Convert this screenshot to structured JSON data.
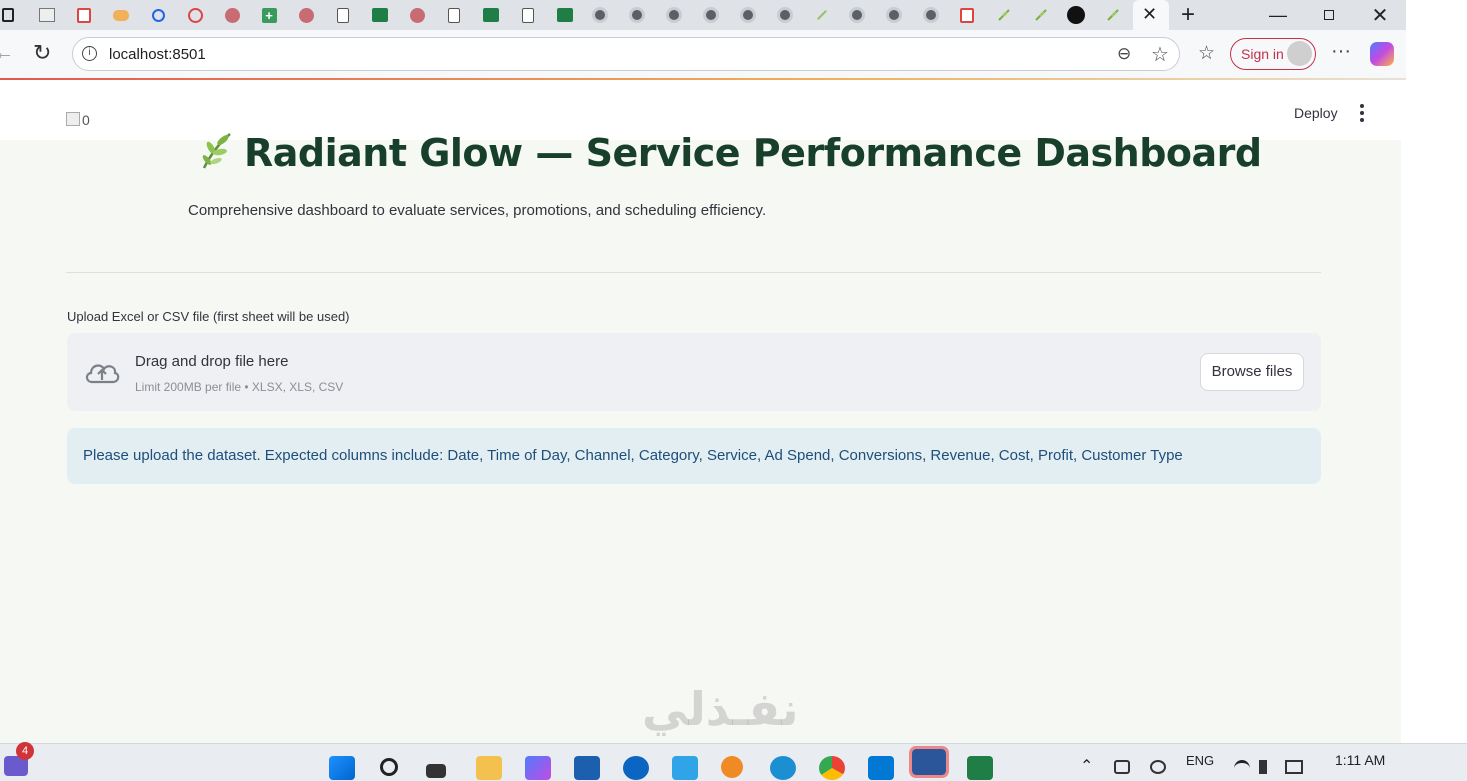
{
  "browser": {
    "url": "localhost:8501",
    "sign_in": "Sign in",
    "tab_icons": [
      "app-icon",
      "image-icon",
      "pdf-icon",
      "label-icon",
      "search-icon",
      "alert-icon",
      "brain-icon",
      "plus-icon",
      "brain-icon",
      "doc-icon",
      "excel-icon",
      "brain-icon",
      "doc-icon",
      "excel-icon",
      "doc-icon",
      "excel-icon",
      "chatgpt-icon",
      "chatgpt-icon",
      "chatgpt-icon",
      "chatgpt-icon",
      "chatgpt-icon",
      "chatgpt-icon",
      "leaf-icon",
      "chatgpt-icon",
      "chatgpt-icon",
      "chatgpt-icon",
      "pdf-icon",
      "leaf-icon",
      "leaf-icon",
      "chart-icon",
      "leaf-icon"
    ]
  },
  "app": {
    "deploy_label": "Deploy",
    "broken_image_alt": "0",
    "title": "Radiant Glow — Service Performance Dashboard",
    "subtitle": "Comprehensive dashboard to evaluate services, promotions, and scheduling efficiency.",
    "uploader": {
      "label": "Upload Excel or CSV file (first sheet will be used)",
      "drop_text": "Drag and drop file here",
      "limit_text": "Limit 200MB per file • XLSX, XLS, CSV",
      "browse_label": "Browse files"
    },
    "info_message": "Please upload the dataset. Expected columns include: Date, Time of Day, Channel, Category, Service, Ad Spend, Conversions, Revenue, Cost, Profit, Customer Type"
  },
  "watermark": "نفـذلي",
  "taskbar": {
    "badge_count": "4",
    "language": "ENG",
    "time": "1:11 AM"
  },
  "colors": {
    "title": "#173f2a",
    "info_bg": "#e3eef3",
    "info_text": "#1e4e7a",
    "sign_in": "#c4314b"
  }
}
